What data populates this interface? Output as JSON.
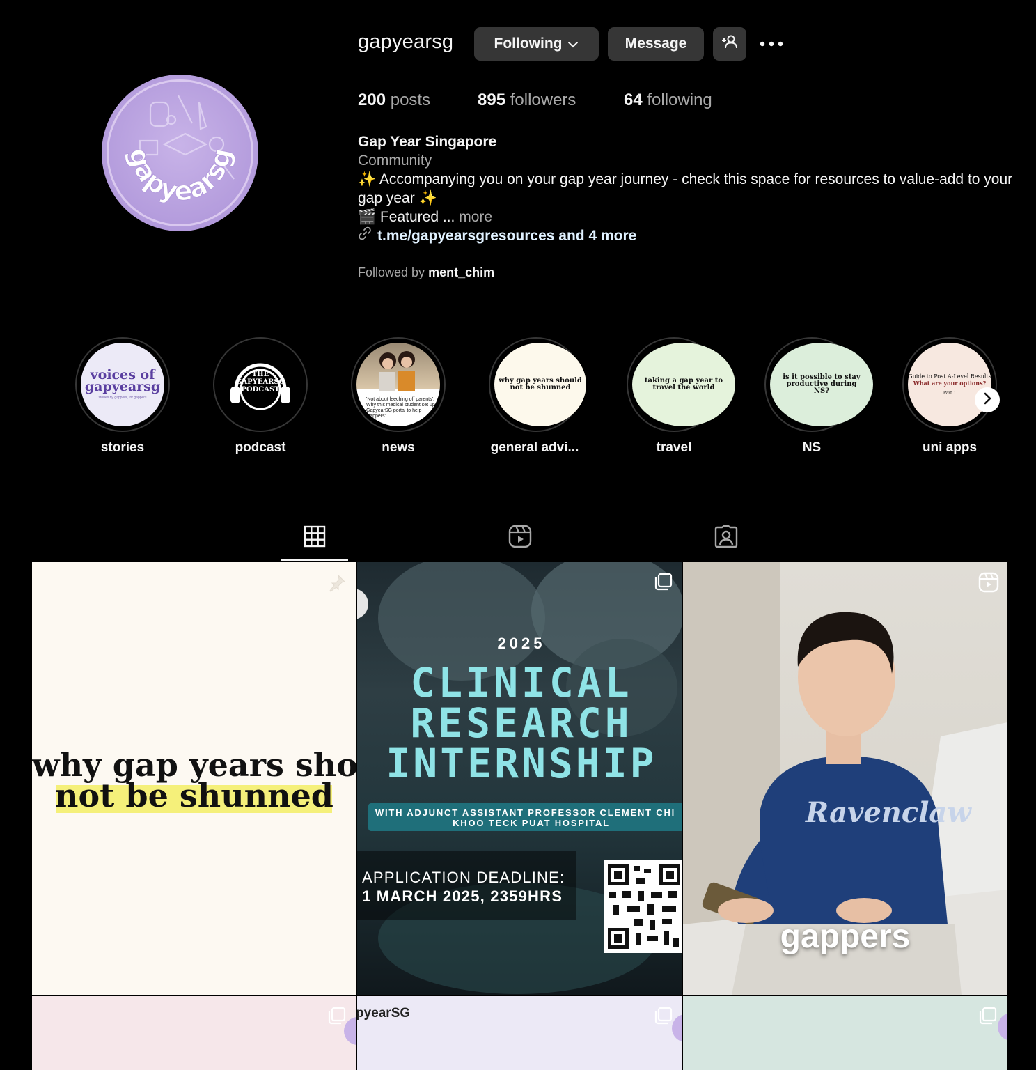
{
  "profile": {
    "username": "gapyearsg",
    "following_label": "Following",
    "message_label": "Message",
    "avatar_text": "gapyearsg"
  },
  "stats": {
    "posts_count": "200",
    "posts_label": " posts",
    "followers_count": "895",
    "followers_label": " followers",
    "following_count": "64",
    "following_label": " following"
  },
  "bio": {
    "name": "Gap Year Singapore",
    "category": "Community",
    "text": "✨ Accompanying you on your gap year journey - check this space for resources to value-add to your gap year ✨",
    "featured": "🎬 Featured ... ",
    "more": "more",
    "link": "t.me/gapyearsgresources and 4 more",
    "followed_by_prefix": "Followed by ",
    "followed_by_user": "ment_chim"
  },
  "highlights": [
    {
      "label": "stories",
      "cover_text": "voices of gapyearsg",
      "cover_sub": "stories by gappers, for gappers"
    },
    {
      "label": "podcast",
      "cover_text": "THE GAPYEARSG PODCAST"
    },
    {
      "label": "news",
      "cover_text": "'Not about leeching off parents': Why this medical student set up GapyearSG portal to help 'gappers'"
    },
    {
      "label": "general advi...",
      "cover_text": "why gap years should not be shunned"
    },
    {
      "label": "travel",
      "cover_text": "taking a gap year to travel the world"
    },
    {
      "label": "NS",
      "cover_text": "is it possible to stay productive during NS?"
    },
    {
      "label": "uni apps",
      "cover_text": "Guide to Post A-Level Results",
      "cover_sub": "What are your options?",
      "cover_part": "Part 1"
    }
  ],
  "posts": {
    "p1_line1": "why gap years should",
    "p1_line2": "not be shunned",
    "p2_year": "2025",
    "p2_title1": "CLINICAL",
    "p2_title2": "RESEARCH",
    "p2_title3": "INTERNSHIP",
    "p2_with": "WITH ADJUNCT ASSISTANT PROFESSOR CLEMENT CHI",
    "p2_hospital": "KHOO TECK PUAT HOSPITAL",
    "p2_deadline1": "APPLICATION DEADLINE:",
    "p2_deadline2": "1 MARCH 2025, 2359HRS",
    "p3_caption": "gappers",
    "p3_shirt": "Ravenclaw",
    "p5_label": "pyearSG"
  },
  "colors": {
    "bg": "#000000",
    "button": "#363636",
    "link": "#e0f1ff",
    "muted": "#a8a8a8",
    "avatar_purple": "#b39bdc",
    "highlight_yellow": "#f5f07a",
    "clinical_teal": "#8fe3e6"
  },
  "icons": {
    "pinned": "pin-icon",
    "carousel": "carousel-icon",
    "reel": "reel-icon",
    "grid_tab": "grid-icon",
    "reels_tab": "reels-icon",
    "tagged_tab": "tagged-icon"
  }
}
